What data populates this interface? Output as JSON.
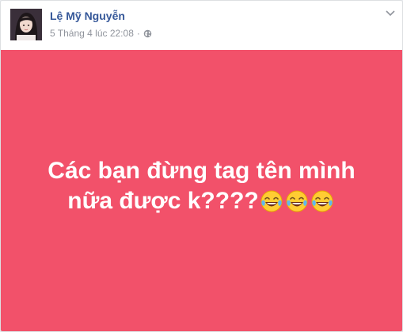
{
  "post": {
    "author_name": "Lệ Mỹ Nguyễn",
    "timestamp": "5 Tháng 4 lúc 22:08",
    "separator": "·",
    "privacy_icon": "globe-icon",
    "menu_icon": "chevron-down-icon",
    "text_line_1": "Các bạn đừng tag tên mình",
    "text_line_2": "nữa được k????",
    "emojis": [
      "laughing-tears-emoji",
      "laughing-tears-emoji",
      "laughing-tears-emoji"
    ],
    "background_color": "#f2516a",
    "text_color": "#ffffff"
  },
  "colors": {
    "name_link": "#365899",
    "meta_text": "#90949c",
    "page_background": "#e9ebee"
  }
}
